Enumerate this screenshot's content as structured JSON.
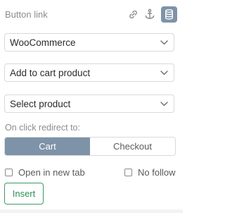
{
  "header": {
    "title": "Button link",
    "icons": [
      "link-icon",
      "anchor-icon",
      "database-icon"
    ],
    "active_icon": "database-icon"
  },
  "selects": {
    "source": {
      "value": "WooCommerce"
    },
    "action": {
      "value": "Add to cart product"
    },
    "product": {
      "value": "Select product"
    }
  },
  "redirect": {
    "label": "On click redirect to:",
    "options": [
      "Cart",
      "Checkout"
    ],
    "selected": "Cart"
  },
  "options": {
    "new_tab": {
      "label": "Open in new tab",
      "checked": false
    },
    "no_follow": {
      "label": "No follow",
      "checked": false
    }
  },
  "actions": {
    "insert_label": "Insert"
  },
  "colors": {
    "accent": "#7e93a8",
    "insert_green": "#2e8f52",
    "border": "#d9d9d9"
  }
}
